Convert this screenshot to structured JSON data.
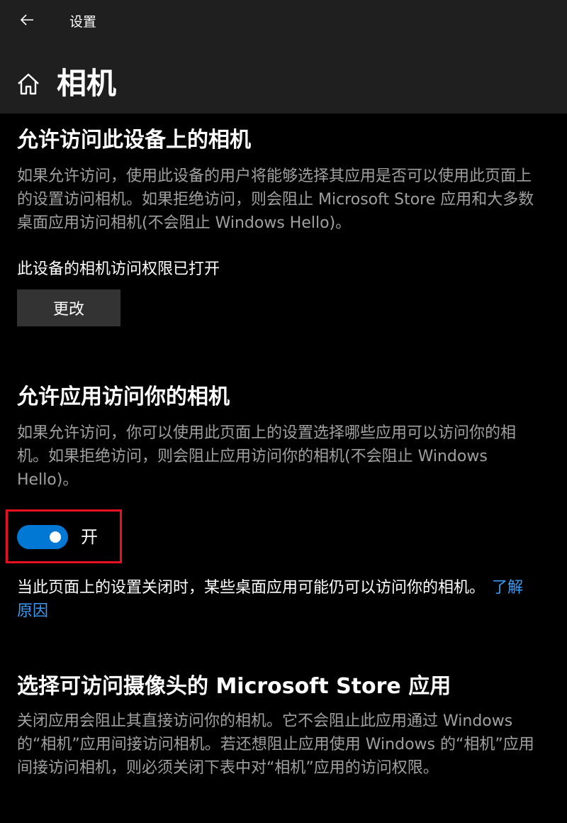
{
  "window": {
    "app_title": "设置"
  },
  "page": {
    "title": "相机"
  },
  "device_access": {
    "heading": "允许访问此设备上的相机",
    "description": "如果允许访问，使用此设备的用户将能够选择其应用是否可以使用此页面上的设置访问相机。如果拒绝访问，则会阻止 Microsoft Store 应用和大多数桌面应用访问相机(不会阻止 Windows Hello)。",
    "status": "此设备的相机访问权限已打开",
    "change_button": "更改"
  },
  "app_access": {
    "heading": "允许应用访问你的相机",
    "description": "如果允许访问，你可以使用此页面上的设置选择哪些应用可以访问你的相机。如果拒绝访问，则会阻止应用访问你的相机(不会阻止 Windows Hello)。",
    "toggle_state": "on",
    "toggle_label": "开",
    "note": "当此页面上的设置关闭时，某些桌面应用可能仍可以访问你的相机。",
    "note_link": "了解原因"
  },
  "store_apps": {
    "heading": "选择可访问摄像头的 Microsoft Store 应用",
    "description": "关闭应用会阻止其直接访问你的相机。它不会阻止此应用通过 Windows 的“相机”应用间接访问相机。若还想阻止应用使用 Windows 的“相机”应用间接访问相机，则必须关闭下表中对“相机”应用的访问权限。"
  },
  "colors": {
    "accent": "#0078d4",
    "link": "#3a9bf5",
    "highlight": "#e81123",
    "secondary_text": "#a0a0a0"
  },
  "icons": {
    "back": "back-arrow-icon",
    "home": "home-icon"
  }
}
